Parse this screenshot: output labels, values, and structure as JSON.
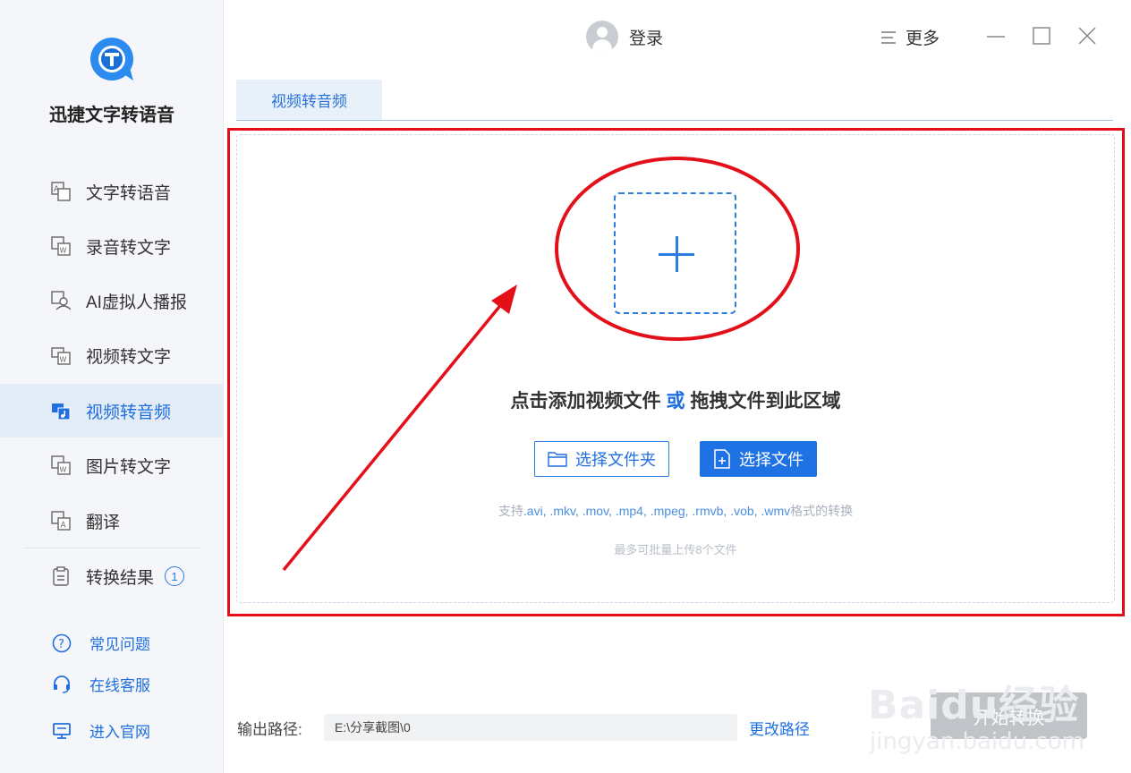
{
  "app": {
    "name": "迅捷文字转语音",
    "accent_color": "#1f6fe0"
  },
  "sidebar": {
    "items": [
      {
        "label": "文字转语音",
        "icon": "text-to-speech-icon"
      },
      {
        "label": "录音转文字",
        "icon": "audio-to-text-icon"
      },
      {
        "label": "AI虚拟人播报",
        "icon": "ai-avatar-icon"
      },
      {
        "label": "视频转文字",
        "icon": "video-to-text-icon"
      },
      {
        "label": "视频转音频",
        "icon": "video-to-audio-icon",
        "active": true
      },
      {
        "label": "图片转文字",
        "icon": "image-to-text-icon"
      },
      {
        "label": "翻译",
        "icon": "translate-icon"
      },
      {
        "label": "转换结果",
        "icon": "clipboard-icon",
        "badge": "1"
      }
    ],
    "help": [
      {
        "label": "常见问题",
        "icon": "question-icon"
      },
      {
        "label": "在线客服",
        "icon": "headset-icon"
      },
      {
        "label": "进入官网",
        "icon": "monitor-icon"
      }
    ]
  },
  "header": {
    "login_label": "登录",
    "more_label": "更多"
  },
  "tabs": [
    {
      "label": "视频转音频",
      "active": true
    }
  ],
  "dropzone": {
    "title_part1": "点击添加视频文件",
    "title_or": "或",
    "title_part2": "拖拽文件到此区域",
    "select_folder_label": "选择文件夹",
    "select_file_label": "选择文件",
    "support_prefix": "支持",
    "support_formats": ".avi, .mkv, .mov, .mp4, .mpeg, .rmvb, .vob, .wmv",
    "support_suffix": "格式的转换",
    "limit_text": "最多可批量上传8个文件"
  },
  "footer": {
    "output_label": "输出路径:",
    "output_path": "E:\\分享截图\\0",
    "change_path_label": "更改路径"
  },
  "watermark": {
    "line1": "Baidu经验",
    "line2": "jingyan.baidu.com",
    "badge": "开始转换"
  }
}
